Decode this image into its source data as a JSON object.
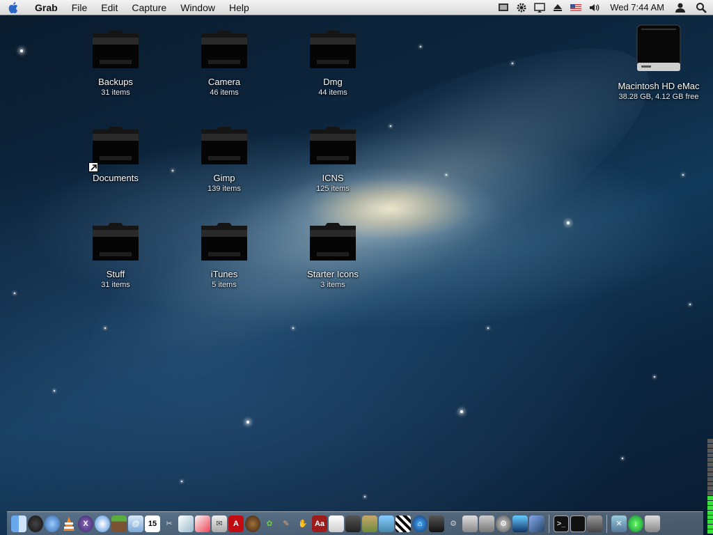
{
  "menubar": {
    "app_name": "Grab",
    "menus": [
      "File",
      "Edit",
      "Capture",
      "Window",
      "Help"
    ],
    "clock": "Wed 7:44 AM",
    "status_icons": [
      "screen-icon",
      "gear-icon",
      "display-icon",
      "eject-icon",
      "us-flag-icon",
      "volume-icon",
      "user-icon",
      "spotlight-icon"
    ]
  },
  "desktop": {
    "folders": [
      {
        "name": "Backups",
        "info": "31 items"
      },
      {
        "name": "Camera",
        "info": "46 items"
      },
      {
        "name": "Dmg",
        "info": "44 items"
      },
      {
        "name": "Documents",
        "info": ""
      },
      {
        "name": "Gimp",
        "info": "139 items"
      },
      {
        "name": "ICNS",
        "info": "125 items"
      },
      {
        "name": "Stuff",
        "info": "31 items"
      },
      {
        "name": "iTunes",
        "info": "5 items"
      },
      {
        "name": "Starter Icons",
        "info": "3 items"
      }
    ],
    "drive": {
      "name": "Macintosh HD eMac",
      "info": "38.28 GB, 4.12 GB free"
    }
  },
  "dock": {
    "calendar_day": "15",
    "dictionary_label": "Aa",
    "level_meter_percent": 40
  }
}
